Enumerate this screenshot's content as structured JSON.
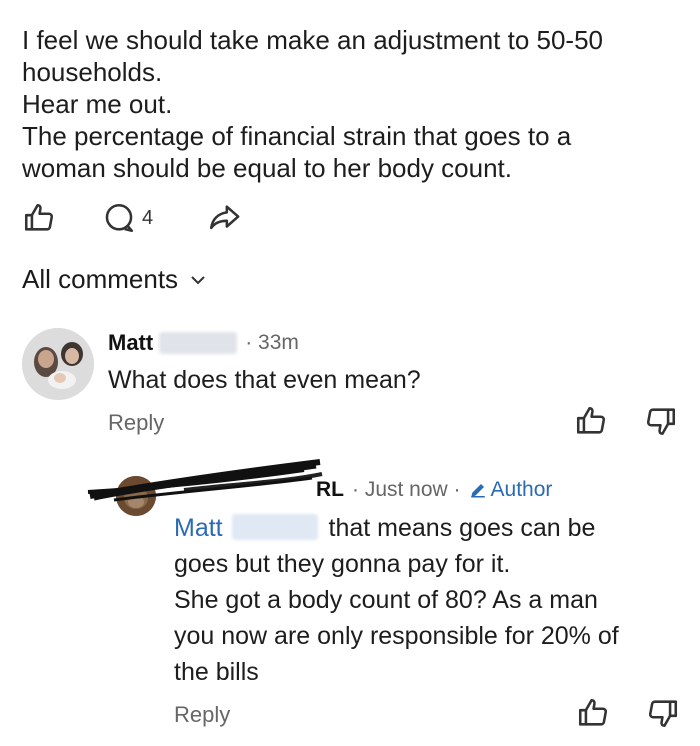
{
  "post": {
    "lines": [
      "I feel we should take make an adjustment to 50-50",
      "households.",
      "Hear me out.",
      "The percentage of financial strain that goes to a",
      "woman should be equal to her body count."
    ],
    "comment_count": "4"
  },
  "comments_header": {
    "label": "All comments"
  },
  "comment1": {
    "author": "Matt",
    "time": "· 33m",
    "body": "What does that even mean?",
    "reply_label": "Reply"
  },
  "comment2": {
    "author_visible_fragment": "RL",
    "time": "· Just now ·",
    "author_badge": "Author",
    "mention": "Matt",
    "body_first": "that means goes can be",
    "body_lines": [
      "goes but they gonna pay for it.",
      "She got a body count of 80? As a man",
      "you now are only responsible for 20% of",
      "the bills"
    ],
    "reply_label": "Reply"
  },
  "icons": {
    "like": "thumbs-up-icon",
    "comment": "comment-bubble-icon",
    "share": "share-arrow-icon",
    "dislike": "thumbs-down-icon",
    "expand": "chevron-down-icon",
    "author": "pencil-icon"
  },
  "colors": {
    "link": "#2a6bb3",
    "muted": "#666666"
  }
}
